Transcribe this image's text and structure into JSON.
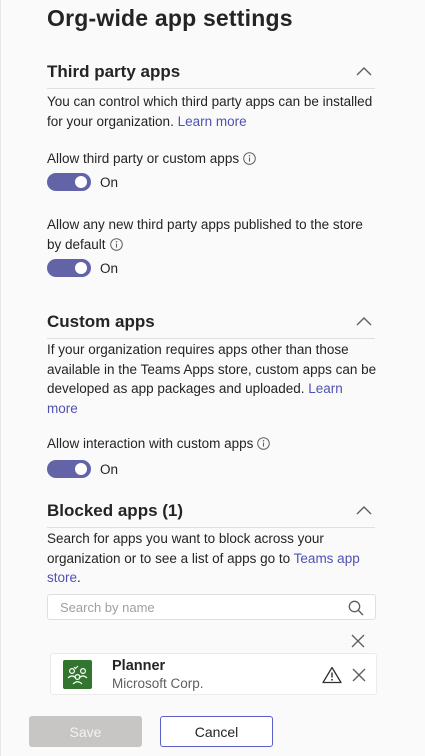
{
  "page": {
    "title": "Org-wide app settings"
  },
  "third_party": {
    "title": "Third party apps",
    "description": "You can control which third party apps can be installed for your organization.",
    "learn_more": "Learn more",
    "allow_label": "Allow third party or custom apps",
    "allow_state": "On",
    "new_apps_label": "Allow any new third party apps published to the store by default",
    "new_apps_state": "On"
  },
  "custom_apps": {
    "title": "Custom apps",
    "description": "If your organization requires apps other than those available in the Teams Apps store, custom apps can be developed as app packages and uploaded.",
    "learn_more": "Learn more",
    "allow_label": "Allow interaction with custom apps",
    "allow_state": "On"
  },
  "blocked_apps": {
    "title": "Blocked apps (1)",
    "description": "Search for apps you want to block across your organization or to see a list of apps go to",
    "store_link": "Teams app store",
    "store_link_suffix": ".",
    "search_placeholder": "Search by name",
    "apps": [
      {
        "name": "Planner",
        "publisher": "Microsoft Corp."
      }
    ]
  },
  "footer": {
    "save_label": "Save",
    "cancel_label": "Cancel"
  },
  "colors": {
    "accent": "#6264a7",
    "link": "#4f52b2",
    "planner_green": "#31752f"
  },
  "icons": {
    "collapse": "chevron-up-icon",
    "info": "info-icon",
    "search": "search-icon",
    "close": "close-icon",
    "warning": "warning-icon",
    "planner": "planner-logo-icon"
  }
}
